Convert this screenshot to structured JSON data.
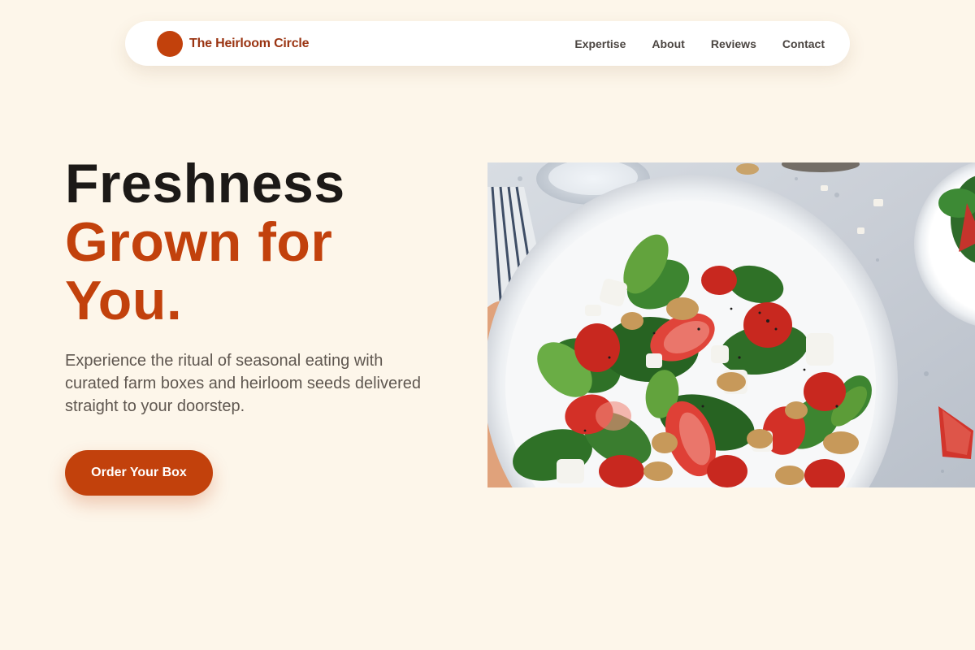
{
  "brand": {
    "name": "The Heirloom Circle"
  },
  "nav": {
    "items": [
      {
        "label": "Expertise"
      },
      {
        "label": "About"
      },
      {
        "label": "Reviews"
      },
      {
        "label": "Contact"
      }
    ]
  },
  "hero": {
    "title_line1": "Freshness",
    "title_accent": "Grown for You.",
    "description": "Experience the ritual of seasonal eating with curated farm boxes and heirloom seeds delivered straight to your doorstep.",
    "cta_label": "Order Your Box"
  },
  "colors": {
    "accent": "#c2410c",
    "background": "#fdf6ea",
    "heading": "#1c1917"
  }
}
